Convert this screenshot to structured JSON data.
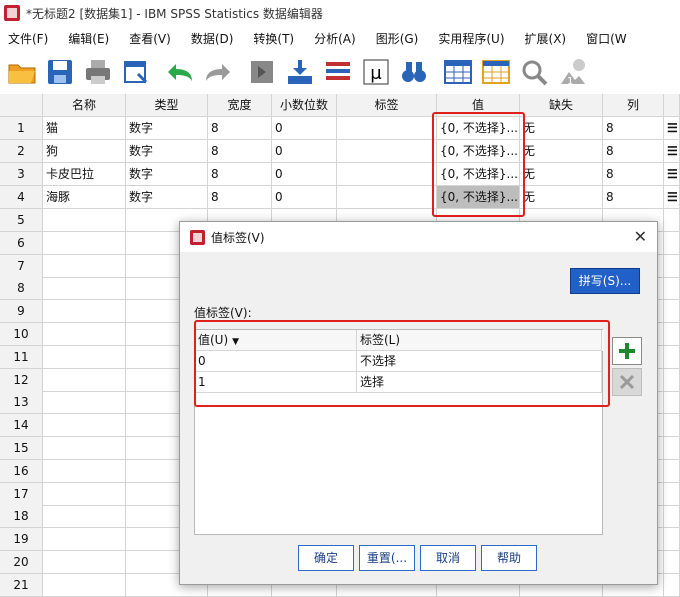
{
  "window": {
    "title": "*无标题2 [数据集1] - IBM SPSS Statistics 数据编辑器"
  },
  "menu": [
    "文件(F)",
    "编辑(E)",
    "查看(V)",
    "数据(D)",
    "转换(T)",
    "分析(A)",
    "图形(G)",
    "实用程序(U)",
    "扩展(X)",
    "窗口(W"
  ],
  "toolbar_icons": [
    "open-folder-icon",
    "save-icon",
    "print-icon",
    "dialog-recall-icon",
    "undo-icon",
    "redo-icon",
    "goto-case-icon",
    "goto-variable-icon",
    "variables-icon",
    "split-file-icon",
    "run-descriptives-icon",
    "find-icon",
    "insert-cases-icon",
    "insert-variable-icon",
    "value-labels-icon",
    "weight-cases-icon"
  ],
  "grid": {
    "headers": [
      "名称",
      "类型",
      "宽度",
      "小数位数",
      "标签",
      "值",
      "缺失",
      "列"
    ],
    "rows": [
      {
        "num": "1",
        "name": "猫",
        "type": "数字",
        "width": "8",
        "dec": "0",
        "label": "",
        "value": "{0, 不选择}...",
        "missing": "无",
        "col": "8"
      },
      {
        "num": "2",
        "name": "狗",
        "type": "数字",
        "width": "8",
        "dec": "0",
        "label": "",
        "value": "{0, 不选择}...",
        "missing": "无",
        "col": "8"
      },
      {
        "num": "3",
        "name": "卡皮巴拉",
        "type": "数字",
        "width": "8",
        "dec": "0",
        "label": "",
        "value": "{0, 不选择}...",
        "missing": "无",
        "col": "8"
      },
      {
        "num": "4",
        "name": "海豚",
        "type": "数字",
        "width": "8",
        "dec": "0",
        "label": "",
        "value": "{0, 不选择}...",
        "missing": "无",
        "col": "8"
      }
    ],
    "empty_row_numbers": [
      "5",
      "6",
      "7",
      "8",
      "9",
      "10",
      "11",
      "12",
      "13",
      "14",
      "15",
      "16",
      "17",
      "18",
      "19",
      "20",
      "21"
    ]
  },
  "dialog": {
    "title": "值标签(V)",
    "spell_button": "拼写(S)...",
    "section_label": "值标签(V):",
    "table_headers": {
      "value": "值(U)",
      "label": "标签(L)"
    },
    "rows": [
      {
        "value": "0",
        "label": "不选择"
      },
      {
        "value": "1",
        "label": "选择"
      }
    ],
    "buttons": {
      "ok": "确定",
      "reset": "重置(...",
      "cancel": "取消",
      "help": "帮助"
    }
  },
  "colors": {
    "highlight": "#e0201d",
    "accent": "#2060c8"
  }
}
